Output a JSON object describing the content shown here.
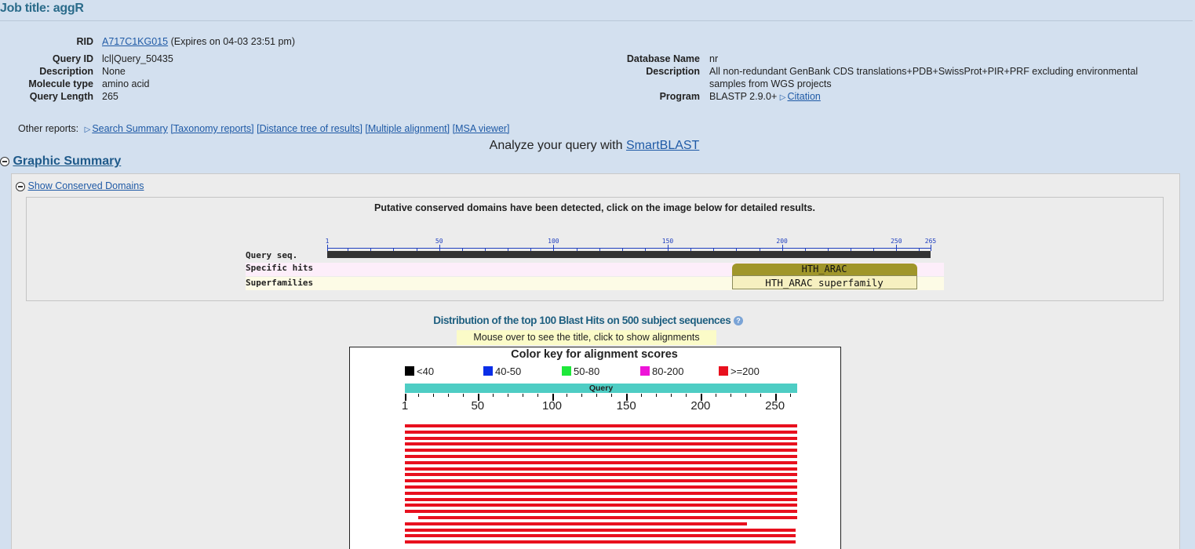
{
  "job_title": "Job title: aggR",
  "left_info": {
    "rid_label": "RID",
    "rid_value": "A717C1KG015",
    "rid_expires": "(Expires on 04-03 23:51 pm)",
    "query_id_label": "Query ID",
    "query_id_value": "lcl|Query_50435",
    "description_label": "Description",
    "description_value": "None",
    "molecule_type_label": "Molecule type",
    "molecule_type_value": "amino acid",
    "query_length_label": "Query Length",
    "query_length_value": "265"
  },
  "right_info": {
    "database_label": "Database Name",
    "database_value": "nr",
    "description_label": "Description",
    "description_line1": "All non-redundant GenBank CDS translations+PDB+SwissProt+PIR+PRF excluding environmental",
    "description_line2": "samples from WGS projects",
    "program_label": "Program",
    "program_value": "BLASTP 2.9.0+",
    "citation_link": "Citation"
  },
  "other_reports": {
    "label": "Other reports:",
    "links": [
      "Search Summary",
      "[Taxonomy reports]",
      "[Distance tree of results]",
      "[Multiple alignment]",
      "[MSA viewer]"
    ]
  },
  "smartblast": {
    "text": "Analyze your query with",
    "link": "SmartBLAST"
  },
  "graphic_summary": {
    "title": "Graphic Summary"
  },
  "conserved_domains": {
    "toggle_label": "Show Conserved Domains",
    "notice": "Putative conserved domains have been detected, click on the image below for detailed results.",
    "row_labels": [
      "Query seq.",
      "Specific hits",
      "Superfamilies"
    ],
    "ruler_ticks": [
      "1",
      "50",
      "100",
      "150",
      "200",
      "250",
      "265"
    ],
    "specific_hit": {
      "name": "HTH_ARAC",
      "start": 178,
      "end": 259,
      "color": "#a0962a"
    },
    "superfamily_hit": {
      "name": "HTH_ARAC superfamily",
      "start": 178,
      "end": 259,
      "color": "#f6f0c0"
    },
    "query_length": 265
  },
  "distribution": {
    "title": "Distribution of the top 100 Blast Hits on 500 subject sequences",
    "help_icon": "question-circle-icon",
    "tooltip": "Mouse over to see the title, click to show alignments",
    "color_key_title": "Color key for alignment scores",
    "color_key": [
      {
        "label": "<40",
        "color": "#000000"
      },
      {
        "label": "40-50",
        "color": "#0a2ee8"
      },
      {
        "label": "50-80",
        "color": "#1ee83a"
      },
      {
        "label": "80-200",
        "color": "#ee14d8"
      },
      {
        "label": ">=200",
        "color": "#e8101e"
      }
    ],
    "query_bar_label": "Query",
    "query_bar_color": "#4ecdc4",
    "axis_ticks": [
      "1",
      "50",
      "100",
      "150",
      "200",
      "250"
    ],
    "hits": [
      {
        "start": 1,
        "end": 265
      },
      {
        "start": 1,
        "end": 265
      },
      {
        "start": 1,
        "end": 265
      },
      {
        "start": 1,
        "end": 265
      },
      {
        "start": 1,
        "end": 265
      },
      {
        "start": 1,
        "end": 265
      },
      {
        "start": 1,
        "end": 265
      },
      {
        "start": 1,
        "end": 265
      },
      {
        "start": 1,
        "end": 265
      },
      {
        "start": 1,
        "end": 265
      },
      {
        "start": 1,
        "end": 265
      },
      {
        "start": 1,
        "end": 265
      },
      {
        "start": 1,
        "end": 265
      },
      {
        "start": 1,
        "end": 265
      },
      {
        "start": 1,
        "end": 265
      },
      {
        "start": 10,
        "end": 265
      },
      {
        "start": 1,
        "end": 231
      },
      {
        "start": 1,
        "end": 264
      },
      {
        "start": 1,
        "end": 264
      },
      {
        "start": 1,
        "end": 264
      }
    ]
  }
}
